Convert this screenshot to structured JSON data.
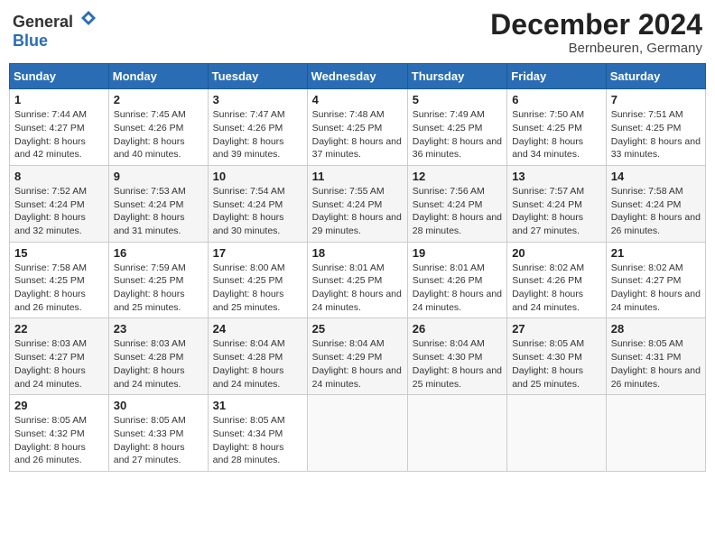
{
  "header": {
    "logo_general": "General",
    "logo_blue": "Blue",
    "month_title": "December 2024",
    "subtitle": "Bernbeuren, Germany"
  },
  "calendar": {
    "days_of_week": [
      "Sunday",
      "Monday",
      "Tuesday",
      "Wednesday",
      "Thursday",
      "Friday",
      "Saturday"
    ],
    "weeks": [
      [
        null,
        {
          "day": "2",
          "sunrise": "Sunrise: 7:45 AM",
          "sunset": "Sunset: 4:26 PM",
          "daylight": "Daylight: 8 hours and 40 minutes."
        },
        {
          "day": "3",
          "sunrise": "Sunrise: 7:47 AM",
          "sunset": "Sunset: 4:26 PM",
          "daylight": "Daylight: 8 hours and 39 minutes."
        },
        {
          "day": "4",
          "sunrise": "Sunrise: 7:48 AM",
          "sunset": "Sunset: 4:25 PM",
          "daylight": "Daylight: 8 hours and 37 minutes."
        },
        {
          "day": "5",
          "sunrise": "Sunrise: 7:49 AM",
          "sunset": "Sunset: 4:25 PM",
          "daylight": "Daylight: 8 hours and 36 minutes."
        },
        {
          "day": "6",
          "sunrise": "Sunrise: 7:50 AM",
          "sunset": "Sunset: 4:25 PM",
          "daylight": "Daylight: 8 hours and 34 minutes."
        },
        {
          "day": "7",
          "sunrise": "Sunrise: 7:51 AM",
          "sunset": "Sunset: 4:25 PM",
          "daylight": "Daylight: 8 hours and 33 minutes."
        }
      ],
      [
        {
          "day": "1",
          "sunrise": "Sunrise: 7:44 AM",
          "sunset": "Sunset: 4:27 PM",
          "daylight": "Daylight: 8 hours and 42 minutes."
        },
        {
          "day": "9",
          "sunrise": "Sunrise: 7:53 AM",
          "sunset": "Sunset: 4:24 PM",
          "daylight": "Daylight: 8 hours and 31 minutes."
        },
        {
          "day": "10",
          "sunrise": "Sunrise: 7:54 AM",
          "sunset": "Sunset: 4:24 PM",
          "daylight": "Daylight: 8 hours and 30 minutes."
        },
        {
          "day": "11",
          "sunrise": "Sunrise: 7:55 AM",
          "sunset": "Sunset: 4:24 PM",
          "daylight": "Daylight: 8 hours and 29 minutes."
        },
        {
          "day": "12",
          "sunrise": "Sunrise: 7:56 AM",
          "sunset": "Sunset: 4:24 PM",
          "daylight": "Daylight: 8 hours and 28 minutes."
        },
        {
          "day": "13",
          "sunrise": "Sunrise: 7:57 AM",
          "sunset": "Sunset: 4:24 PM",
          "daylight": "Daylight: 8 hours and 27 minutes."
        },
        {
          "day": "14",
          "sunrise": "Sunrise: 7:58 AM",
          "sunset": "Sunset: 4:24 PM",
          "daylight": "Daylight: 8 hours and 26 minutes."
        }
      ],
      [
        {
          "day": "8",
          "sunrise": "Sunrise: 7:52 AM",
          "sunset": "Sunset: 4:24 PM",
          "daylight": "Daylight: 8 hours and 32 minutes."
        },
        {
          "day": "16",
          "sunrise": "Sunrise: 7:59 AM",
          "sunset": "Sunset: 4:25 PM",
          "daylight": "Daylight: 8 hours and 25 minutes."
        },
        {
          "day": "17",
          "sunrise": "Sunrise: 8:00 AM",
          "sunset": "Sunset: 4:25 PM",
          "daylight": "Daylight: 8 hours and 25 minutes."
        },
        {
          "day": "18",
          "sunrise": "Sunrise: 8:01 AM",
          "sunset": "Sunset: 4:25 PM",
          "daylight": "Daylight: 8 hours and 24 minutes."
        },
        {
          "day": "19",
          "sunrise": "Sunrise: 8:01 AM",
          "sunset": "Sunset: 4:26 PM",
          "daylight": "Daylight: 8 hours and 24 minutes."
        },
        {
          "day": "20",
          "sunrise": "Sunrise: 8:02 AM",
          "sunset": "Sunset: 4:26 PM",
          "daylight": "Daylight: 8 hours and 24 minutes."
        },
        {
          "day": "21",
          "sunrise": "Sunrise: 8:02 AM",
          "sunset": "Sunset: 4:27 PM",
          "daylight": "Daylight: 8 hours and 24 minutes."
        }
      ],
      [
        {
          "day": "15",
          "sunrise": "Sunrise: 7:58 AM",
          "sunset": "Sunset: 4:25 PM",
          "daylight": "Daylight: 8 hours and 26 minutes."
        },
        {
          "day": "23",
          "sunrise": "Sunrise: 8:03 AM",
          "sunset": "Sunset: 4:28 PM",
          "daylight": "Daylight: 8 hours and 24 minutes."
        },
        {
          "day": "24",
          "sunrise": "Sunrise: 8:04 AM",
          "sunset": "Sunset: 4:28 PM",
          "daylight": "Daylight: 8 hours and 24 minutes."
        },
        {
          "day": "25",
          "sunrise": "Sunrise: 8:04 AM",
          "sunset": "Sunset: 4:29 PM",
          "daylight": "Daylight: 8 hours and 24 minutes."
        },
        {
          "day": "26",
          "sunrise": "Sunrise: 8:04 AM",
          "sunset": "Sunset: 4:30 PM",
          "daylight": "Daylight: 8 hours and 25 minutes."
        },
        {
          "day": "27",
          "sunrise": "Sunrise: 8:05 AM",
          "sunset": "Sunset: 4:30 PM",
          "daylight": "Daylight: 8 hours and 25 minutes."
        },
        {
          "day": "28",
          "sunrise": "Sunrise: 8:05 AM",
          "sunset": "Sunset: 4:31 PM",
          "daylight": "Daylight: 8 hours and 26 minutes."
        }
      ],
      [
        {
          "day": "22",
          "sunrise": "Sunrise: 8:03 AM",
          "sunset": "Sunset: 4:27 PM",
          "daylight": "Daylight: 8 hours and 24 minutes."
        },
        {
          "day": "30",
          "sunrise": "Sunrise: 8:05 AM",
          "sunset": "Sunset: 4:33 PM",
          "daylight": "Daylight: 8 hours and 27 minutes."
        },
        {
          "day": "31",
          "sunrise": "Sunrise: 8:05 AM",
          "sunset": "Sunset: 4:34 PM",
          "daylight": "Daylight: 8 hours and 28 minutes."
        },
        null,
        null,
        null,
        null
      ],
      [
        {
          "day": "29",
          "sunrise": "Sunrise: 8:05 AM",
          "sunset": "Sunset: 4:32 PM",
          "daylight": "Daylight: 8 hours and 26 minutes."
        },
        null,
        null,
        null,
        null,
        null,
        null
      ]
    ]
  }
}
